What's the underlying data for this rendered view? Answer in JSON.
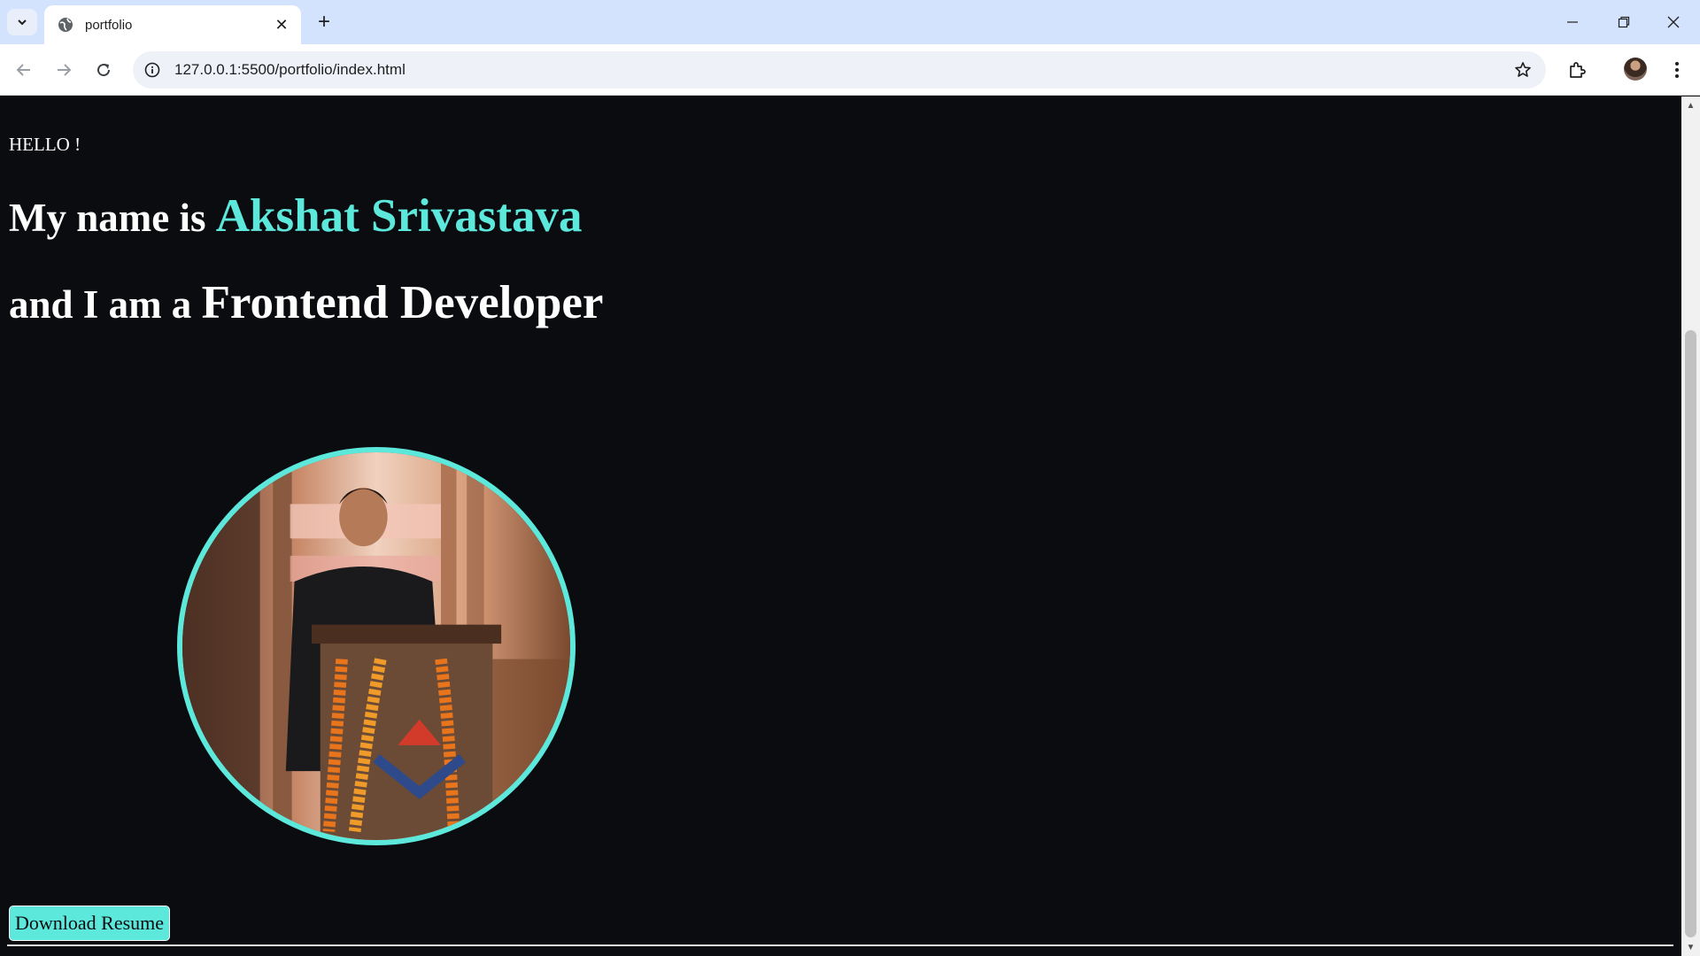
{
  "browser": {
    "tab_title": "portfolio",
    "url": "127.0.0.1:5500/portfolio/index.html",
    "icons": [
      "chevron-down-icon",
      "globe-icon",
      "close-icon",
      "plus-icon",
      "minimize-icon",
      "restore-icon",
      "close-window-icon",
      "back-icon",
      "forward-icon",
      "reload-icon",
      "info-icon",
      "star-icon",
      "extensions-icon",
      "profile-avatar",
      "more-menu-icon"
    ]
  },
  "page": {
    "greeting": "HELLO !",
    "intro_prefix": "My name is",
    "name": "Akshat Srivastava",
    "role_prefix": "and I am a",
    "role": "Frontend Developer",
    "download_label": "Download Resume",
    "colors": {
      "background": "#0a0c10",
      "accent": "#5de8dc",
      "text": "#ffffff"
    }
  }
}
